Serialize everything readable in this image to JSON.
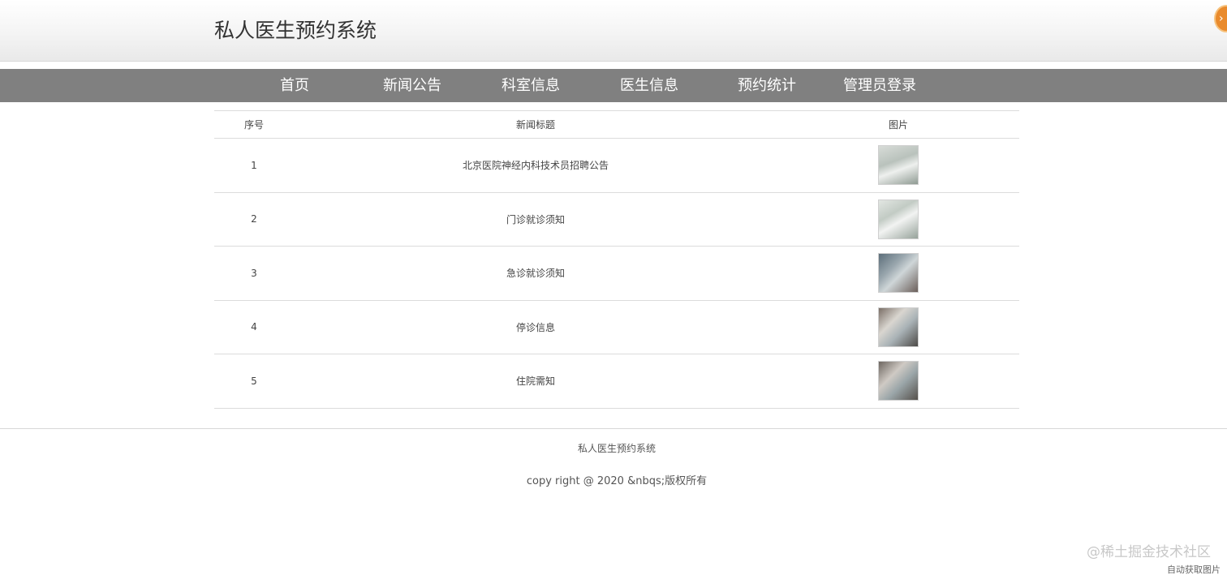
{
  "header": {
    "site_title": "私人医生预约系统"
  },
  "nav": {
    "items": [
      {
        "label": "首页"
      },
      {
        "label": "新闻公告"
      },
      {
        "label": "科室信息"
      },
      {
        "label": "医生信息"
      },
      {
        "label": "预约统计"
      },
      {
        "label": "管理员登录"
      }
    ]
  },
  "table": {
    "headers": {
      "index": "序号",
      "title": "新闻标题",
      "image": "图片"
    },
    "rows": [
      {
        "index": "1",
        "title": "北京医院神经内科技术员招聘公告"
      },
      {
        "index": "2",
        "title": "门诊就诊须知"
      },
      {
        "index": "3",
        "title": "急诊就诊须知"
      },
      {
        "index": "4",
        "title": "停诊信息"
      },
      {
        "index": "5",
        "title": "住院需知"
      }
    ]
  },
  "footer": {
    "title": "私人医生预约系统",
    "copyright": "copy right @ 2020 &nbqs;版权所有"
  },
  "overlay": {
    "watermark": "@稀土掘金技术社区",
    "auto_fetch": "自动获取图片"
  }
}
